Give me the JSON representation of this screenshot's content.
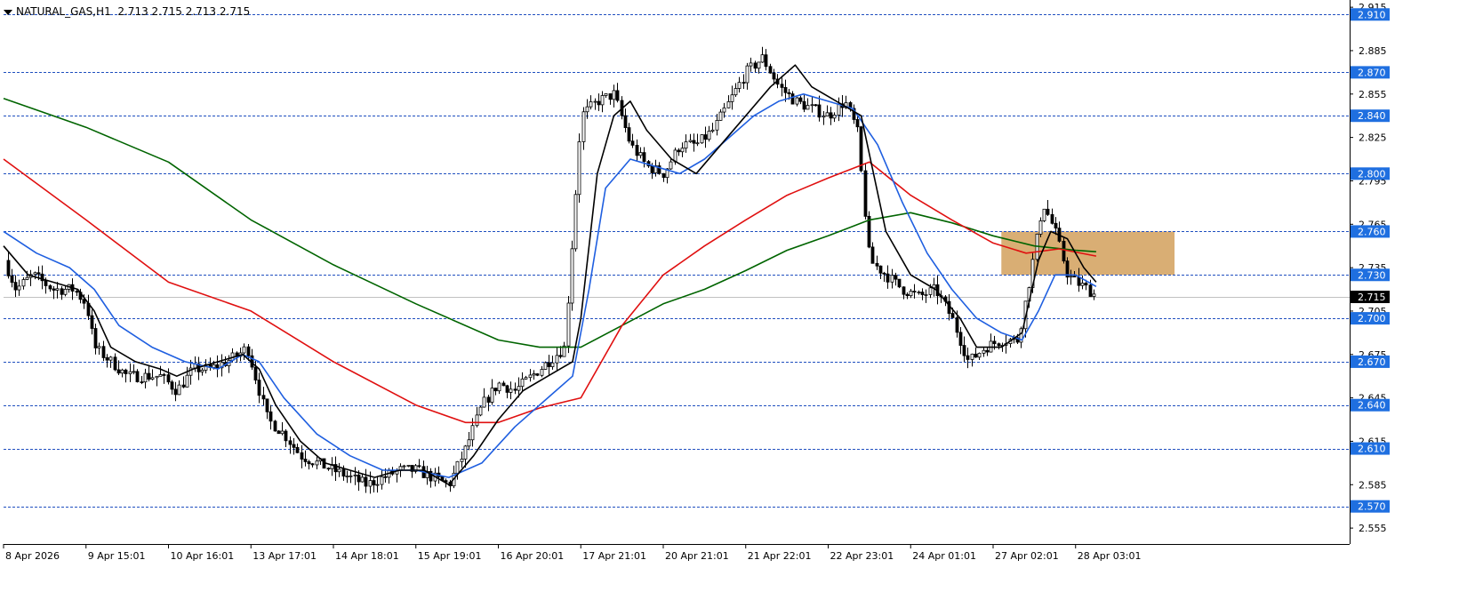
{
  "header": {
    "symbol": "NATURAL_GAS,H1",
    "ohlc": "2.713 2.715 2.713 2.715"
  },
  "colors": {
    "background": "#ffffff",
    "axis": "#000000",
    "candle": "#000000",
    "ma_fast": "#000000",
    "ma_blue": "#1f5fe0",
    "ma_red": "#e01010",
    "ma_green": "#006400",
    "level_line": "#1f4fbf",
    "level_badge": "#1f6fe0",
    "current_badge": "#000000",
    "zone": "#d9ae74"
  },
  "chart_data": {
    "type": "line",
    "instrument": "NATURAL_GAS",
    "timeframe": "H1",
    "ylim": [
      2.544,
      2.92
    ],
    "y_ticks": [
      "2.915",
      "2.885",
      "2.855",
      "2.825",
      "2.795",
      "2.765",
      "2.735",
      "2.705",
      "2.675",
      "2.645",
      "2.615",
      "2.585",
      "2.555"
    ],
    "x_ticks": [
      "8 Apr 2026",
      "9 Apr 15:01",
      "10 Apr 16:01",
      "13 Apr 17:01",
      "14 Apr 18:01",
      "15 Apr 19:01",
      "16 Apr 20:01",
      "17 Apr 21:01",
      "20 Apr 21:01",
      "21 Apr 22:01",
      "22 Apr 23:01",
      "24 Apr 01:01",
      "27 Apr 02:01",
      "28 Apr 03:01"
    ],
    "levels": [
      "2.910",
      "2.870",
      "2.840",
      "2.800",
      "2.760",
      "2.730",
      "2.700",
      "2.670",
      "2.640",
      "2.610",
      "2.570"
    ],
    "current_price": "2.715",
    "zone": {
      "y_top": 2.76,
      "y_bottom": 2.73,
      "x_start": 12.1,
      "x_end": 14.2
    },
    "series": [
      {
        "key": "price",
        "values": [
          [
            0,
            2.74
          ],
          [
            0.15,
            2.72
          ],
          [
            0.35,
            2.73
          ],
          [
            0.6,
            2.72
          ],
          [
            0.85,
            2.72
          ],
          [
            1.0,
            2.71
          ],
          [
            1.1,
            2.68
          ],
          [
            1.3,
            2.67
          ],
          [
            1.5,
            2.66
          ],
          [
            1.7,
            2.66
          ],
          [
            1.9,
            2.66
          ],
          [
            2.1,
            2.65
          ],
          [
            2.3,
            2.665
          ],
          [
            2.5,
            2.665
          ],
          [
            2.7,
            2.67
          ],
          [
            2.85,
            2.675
          ],
          [
            2.95,
            2.68
          ],
          [
            3.05,
            2.66
          ],
          [
            3.2,
            2.63
          ],
          [
            3.4,
            2.62
          ],
          [
            3.6,
            2.605
          ],
          [
            3.8,
            2.6
          ],
          [
            4.0,
            2.595
          ],
          [
            4.2,
            2.59
          ],
          [
            4.4,
            2.585
          ],
          [
            4.6,
            2.59
          ],
          [
            4.8,
            2.595
          ],
          [
            5.0,
            2.595
          ],
          [
            5.2,
            2.59
          ],
          [
            5.4,
            2.585
          ],
          [
            5.6,
            2.61
          ],
          [
            5.8,
            2.64
          ],
          [
            6.0,
            2.655
          ],
          [
            6.2,
            2.65
          ],
          [
            6.4,
            2.66
          ],
          [
            6.6,
            2.67
          ],
          [
            6.8,
            2.68
          ],
          [
            7.0,
            2.84
          ],
          [
            7.2,
            2.85
          ],
          [
            7.4,
            2.855
          ],
          [
            7.6,
            2.82
          ],
          [
            7.8,
            2.805
          ],
          [
            8.0,
            2.8
          ],
          [
            8.2,
            2.82
          ],
          [
            8.4,
            2.82
          ],
          [
            8.6,
            2.83
          ],
          [
            8.8,
            2.85
          ],
          [
            9.0,
            2.87
          ],
          [
            9.2,
            2.88
          ],
          [
            9.4,
            2.86
          ],
          [
            9.6,
            2.85
          ],
          [
            9.8,
            2.845
          ],
          [
            10.0,
            2.84
          ],
          [
            10.2,
            2.85
          ],
          [
            10.35,
            2.83
          ],
          [
            10.5,
            2.74
          ],
          [
            10.7,
            2.73
          ],
          [
            10.9,
            2.72
          ],
          [
            11.1,
            2.715
          ],
          [
            11.3,
            2.72
          ],
          [
            11.5,
            2.7
          ],
          [
            11.7,
            2.67
          ],
          [
            11.9,
            2.68
          ],
          [
            12.1,
            2.685
          ],
          [
            12.3,
            2.685
          ],
          [
            12.45,
            2.73
          ],
          [
            12.6,
            2.78
          ],
          [
            12.75,
            2.76
          ],
          [
            12.9,
            2.73
          ],
          [
            13.0,
            2.725
          ],
          [
            13.15,
            2.72
          ],
          [
            13.25,
            2.715
          ]
        ]
      },
      {
        "key": "ma_fast",
        "values": [
          [
            0,
            2.75
          ],
          [
            0.3,
            2.73
          ],
          [
            0.6,
            2.725
          ],
          [
            0.9,
            2.72
          ],
          [
            1.1,
            2.705
          ],
          [
            1.3,
            2.68
          ],
          [
            1.6,
            2.67
          ],
          [
            1.9,
            2.665
          ],
          [
            2.1,
            2.66
          ],
          [
            2.3,
            2.665
          ],
          [
            2.6,
            2.67
          ],
          [
            2.9,
            2.675
          ],
          [
            3.1,
            2.665
          ],
          [
            3.3,
            2.64
          ],
          [
            3.6,
            2.615
          ],
          [
            3.9,
            2.6
          ],
          [
            4.2,
            2.595
          ],
          [
            4.5,
            2.59
          ],
          [
            4.8,
            2.595
          ],
          [
            5.1,
            2.595
          ],
          [
            5.4,
            2.585
          ],
          [
            5.7,
            2.605
          ],
          [
            6.0,
            2.63
          ],
          [
            6.3,
            2.65
          ],
          [
            6.6,
            2.66
          ],
          [
            6.9,
            2.67
          ],
          [
            7.0,
            2.7
          ],
          [
            7.2,
            2.8
          ],
          [
            7.4,
            2.84
          ],
          [
            7.6,
            2.85
          ],
          [
            7.8,
            2.83
          ],
          [
            8.1,
            2.81
          ],
          [
            8.4,
            2.8
          ],
          [
            8.7,
            2.82
          ],
          [
            9.0,
            2.84
          ],
          [
            9.3,
            2.86
          ],
          [
            9.6,
            2.875
          ],
          [
            9.8,
            2.86
          ],
          [
            10.1,
            2.85
          ],
          [
            10.4,
            2.84
          ],
          [
            10.55,
            2.8
          ],
          [
            10.7,
            2.76
          ],
          [
            11.0,
            2.73
          ],
          [
            11.3,
            2.72
          ],
          [
            11.6,
            2.7
          ],
          [
            11.8,
            2.68
          ],
          [
            12.1,
            2.68
          ],
          [
            12.35,
            2.69
          ],
          [
            12.55,
            2.74
          ],
          [
            12.7,
            2.76
          ],
          [
            12.9,
            2.755
          ],
          [
            13.1,
            2.735
          ],
          [
            13.25,
            2.725
          ]
        ]
      },
      {
        "key": "ma_blue",
        "values": [
          [
            0,
            2.76
          ],
          [
            0.4,
            2.745
          ],
          [
            0.8,
            2.735
          ],
          [
            1.1,
            2.72
          ],
          [
            1.4,
            2.695
          ],
          [
            1.8,
            2.68
          ],
          [
            2.2,
            2.67
          ],
          [
            2.6,
            2.665
          ],
          [
            2.9,
            2.675
          ],
          [
            3.1,
            2.67
          ],
          [
            3.4,
            2.645
          ],
          [
            3.8,
            2.62
          ],
          [
            4.2,
            2.605
          ],
          [
            4.6,
            2.595
          ],
          [
            5.0,
            2.595
          ],
          [
            5.4,
            2.59
          ],
          [
            5.8,
            2.6
          ],
          [
            6.2,
            2.625
          ],
          [
            6.6,
            2.645
          ],
          [
            6.9,
            2.66
          ],
          [
            7.1,
            2.72
          ],
          [
            7.3,
            2.79
          ],
          [
            7.6,
            2.81
          ],
          [
            7.9,
            2.805
          ],
          [
            8.2,
            2.8
          ],
          [
            8.5,
            2.81
          ],
          [
            8.8,
            2.825
          ],
          [
            9.1,
            2.84
          ],
          [
            9.4,
            2.85
          ],
          [
            9.7,
            2.855
          ],
          [
            10.0,
            2.85
          ],
          [
            10.3,
            2.845
          ],
          [
            10.6,
            2.82
          ],
          [
            10.9,
            2.78
          ],
          [
            11.2,
            2.745
          ],
          [
            11.5,
            2.72
          ],
          [
            11.8,
            2.7
          ],
          [
            12.1,
            2.69
          ],
          [
            12.35,
            2.685
          ],
          [
            12.55,
            2.705
          ],
          [
            12.75,
            2.73
          ],
          [
            13.0,
            2.73
          ],
          [
            13.25,
            2.722
          ]
        ]
      },
      {
        "key": "ma_red",
        "values": [
          [
            0,
            2.81
          ],
          [
            1,
            2.768
          ],
          [
            2,
            2.725
          ],
          [
            3,
            2.705
          ],
          [
            4,
            2.67
          ],
          [
            5,
            2.64
          ],
          [
            5.6,
            2.628
          ],
          [
            6.0,
            2.628
          ],
          [
            6.5,
            2.638
          ],
          [
            7.0,
            2.645
          ],
          [
            7.5,
            2.695
          ],
          [
            8.0,
            2.73
          ],
          [
            8.5,
            2.75
          ],
          [
            9.0,
            2.768
          ],
          [
            9.5,
            2.785
          ],
          [
            10.0,
            2.797
          ],
          [
            10.5,
            2.808
          ],
          [
            11.0,
            2.785
          ],
          [
            11.5,
            2.768
          ],
          [
            12.0,
            2.752
          ],
          [
            12.4,
            2.745
          ],
          [
            12.8,
            2.748
          ],
          [
            13.25,
            2.743
          ]
        ]
      },
      {
        "key": "ma_green",
        "values": [
          [
            0,
            2.852
          ],
          [
            1,
            2.832
          ],
          [
            2,
            2.808
          ],
          [
            3,
            2.768
          ],
          [
            4,
            2.737
          ],
          [
            5,
            2.71
          ],
          [
            6,
            2.685
          ],
          [
            6.5,
            2.68
          ],
          [
            7.0,
            2.68
          ],
          [
            7.5,
            2.695
          ],
          [
            8.0,
            2.71
          ],
          [
            8.5,
            2.72
          ],
          [
            9.0,
            2.733
          ],
          [
            9.5,
            2.747
          ],
          [
            10.0,
            2.757
          ],
          [
            10.5,
            2.768
          ],
          [
            11.0,
            2.773
          ],
          [
            11.5,
            2.766
          ],
          [
            12.0,
            2.757
          ],
          [
            12.5,
            2.75
          ],
          [
            13.0,
            2.747
          ],
          [
            13.25,
            2.746
          ]
        ]
      }
    ]
  }
}
